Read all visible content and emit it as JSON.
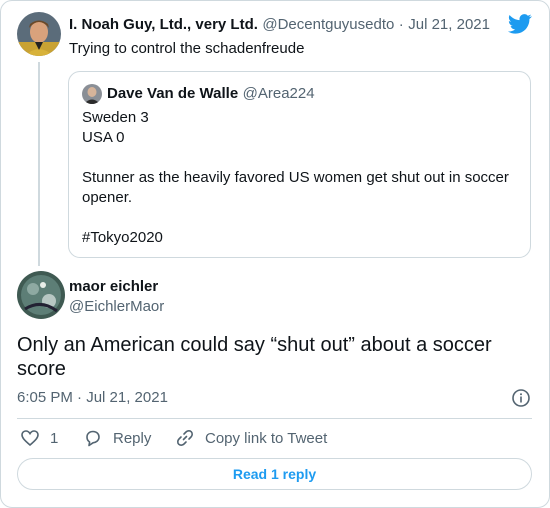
{
  "parent_tweet": {
    "display_name": "I. Noah Guy, Ltd., very Ltd.",
    "handle": "@Decentguyusedto",
    "separator": "·",
    "date": "Jul 21, 2021",
    "text": "Trying to control the schadenfreude"
  },
  "quoted_tweet": {
    "display_name": "Dave Van de Walle",
    "handle": "@Area224",
    "lines": [
      "Sweden 3",
      "USA 0",
      "Stunner as the heavily favored US women get shut out in soccer",
      "opener.",
      "#Tokyo2020"
    ]
  },
  "main_tweet": {
    "display_name": "maor eichler",
    "handle": "@EichlerMaor",
    "text_line1": "Only an American could say “shut out” about a soccer",
    "text_line2": "score",
    "timestamp": "6:05 PM · Jul 21, 2021"
  },
  "actions": {
    "like_count": "1",
    "reply_label": "Reply",
    "copy_link_label": "Copy link to Tweet"
  },
  "read_reply_label": "Read 1 reply",
  "colors": {
    "twitter_blue": "#1d9bf0",
    "muted": "#536471",
    "border": "#cfd9de"
  },
  "icons": [
    "twitter-bird-icon",
    "info-icon",
    "heart-icon",
    "reply-icon",
    "link-icon"
  ]
}
